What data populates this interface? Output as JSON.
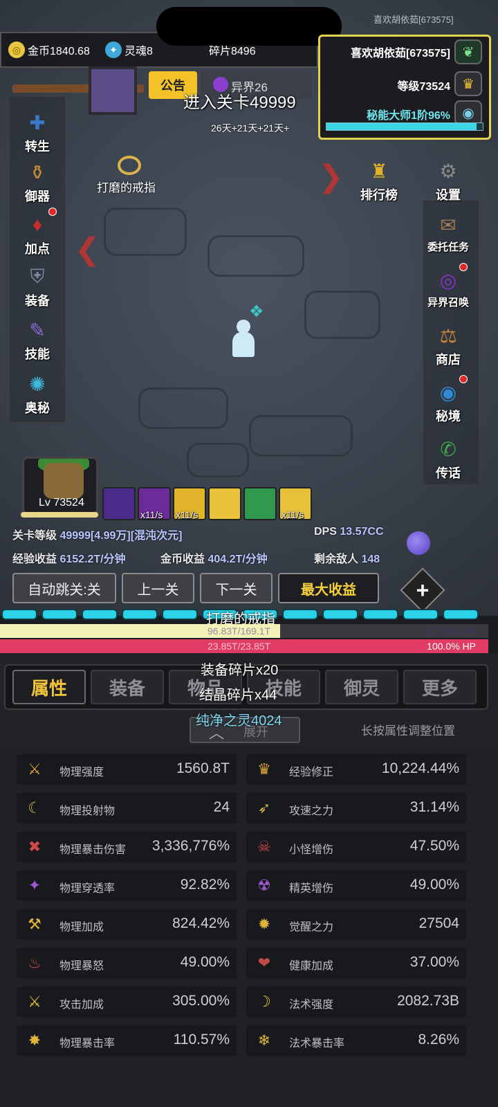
{
  "status": {
    "user_top": "喜欢胡依茹[673575]"
  },
  "resources": {
    "gold": "金币1840.68",
    "soul": "灵魂8",
    "fragment": "碎片8496"
  },
  "player": {
    "name": "喜欢胡依茹[673575]",
    "level": "等级73524",
    "rank": "秘能大师1阶96%",
    "rank_progress": 0.96
  },
  "tabs_top": {
    "notice": "公告",
    "world": "异界26"
  },
  "stage": {
    "enter_text": "进入关卡49999",
    "buff_days": "26天+21天+21天+"
  },
  "drop": {
    "ring_label": "打磨的戒指"
  },
  "left_menu": [
    {
      "label": "转生",
      "icon": "rebirth-icon",
      "dot": false
    },
    {
      "label": "御器",
      "icon": "artifact-icon",
      "dot": false
    },
    {
      "label": "加点",
      "icon": "attribute-point-icon",
      "dot": true
    },
    {
      "label": "装备",
      "icon": "equipment-icon",
      "dot": false
    },
    {
      "label": "技能",
      "icon": "skill-scroll-icon",
      "dot": false
    },
    {
      "label": "奥秘",
      "icon": "mystery-icon",
      "dot": false
    }
  ],
  "right_menu": [
    {
      "label": "排行榜",
      "icon": "trophy-icon",
      "dot": false
    },
    {
      "label": "设置",
      "icon": "gear-icon",
      "dot": false
    },
    {
      "label": "委托任务",
      "icon": "commission-icon",
      "dot": false
    },
    {
      "label": "异界召唤",
      "icon": "portal-icon",
      "dot": true
    },
    {
      "label": "商店",
      "icon": "shop-icon",
      "dot": false
    },
    {
      "label": "秘境",
      "icon": "secret-realm-icon",
      "dot": true
    },
    {
      "label": "传话",
      "icon": "horn-icon",
      "dot": false
    }
  ],
  "boss": {
    "level": "Lv 73524"
  },
  "skills": [
    {
      "rate": "",
      "color": "#4a2b8a"
    },
    {
      "rate": "x11/s",
      "color": "#6b2b9a"
    },
    {
      "rate": "x11/s",
      "color": "#e0b32a"
    },
    {
      "rate": "",
      "color": "#e8c23a"
    },
    {
      "rate": "",
      "color": "#2f9a4c"
    },
    {
      "rate": "x11/s",
      "color": "#e6c23a"
    }
  ],
  "info": {
    "stage_level_label": "关卡等级",
    "stage_level_value": "49999[4.99万][混沌次元]",
    "dps_label": "DPS",
    "dps_value": "13.57CC",
    "exp_income_label": "经验收益",
    "exp_income_value": "6152.2T/分钟",
    "gold_income_label": "金币收益",
    "gold_income_value": "404.2T/分钟",
    "enemies_label": "剩余敌人",
    "enemies_value": "148"
  },
  "controls": {
    "auto_skip": "自动跳关:关",
    "prev": "上一关",
    "next": "下一关",
    "max_income": "最大收益",
    "plus": "+"
  },
  "progress": {
    "segment_label": "打磨的戒指",
    "segments": 12,
    "exp_text": "96.83T/169.1T",
    "exp_percent": "57.3% EXP",
    "exp_fraction": 0.573,
    "hp_text": "23.85T/23.85T",
    "hp_percent": "100.0% HP",
    "hp_fraction": 1.0
  },
  "bottom_tabs": [
    "属性",
    "装备",
    "物品",
    "技能",
    "御灵",
    "更多"
  ],
  "popups": [
    "装备碎片x20",
    "结晶碎片x44",
    "纯净之灵4024"
  ],
  "panel": {
    "expand": "展开",
    "hint": "长按属性调整位置"
  },
  "stats_left": [
    {
      "name": "物理强度",
      "value": "1560.8T",
      "icon": "sword-icon"
    },
    {
      "name": "物理投射物",
      "value": "24",
      "icon": "boomerang-icon"
    },
    {
      "name": "物理暴击伤害",
      "value": "3,336,776%",
      "icon": "crit-damage-icon"
    },
    {
      "name": "物理穿透率",
      "value": "92.82%",
      "icon": "penetration-icon"
    },
    {
      "name": "物理加成",
      "value": "824.42%",
      "icon": "physical-bonus-icon"
    },
    {
      "name": "物理暴怒",
      "value": "49.00%",
      "icon": "rage-icon"
    },
    {
      "name": "攻击加成",
      "value": "305.00%",
      "icon": "crossed-swords-icon"
    },
    {
      "name": "物理暴击率",
      "value": "110.57%",
      "icon": "crit-rate-icon"
    }
  ],
  "stats_right": [
    {
      "name": "经验修正",
      "value": "10,224.44%",
      "icon": "crown-icon"
    },
    {
      "name": "攻速之力",
      "value": "31.14%",
      "icon": "attack-speed-icon"
    },
    {
      "name": "小怪增伤",
      "value": "47.50%",
      "icon": "minion-damage-icon"
    },
    {
      "name": "精英增伤",
      "value": "49.00%",
      "icon": "elite-damage-icon"
    },
    {
      "name": "觉醒之力",
      "value": "27504",
      "icon": "awaken-icon"
    },
    {
      "name": "健康加成",
      "value": "37.00%",
      "icon": "health-heart-icon"
    },
    {
      "name": "法术强度",
      "value": "2082.73B",
      "icon": "spell-power-icon"
    },
    {
      "name": "法术暴击率",
      "value": "8.26%",
      "icon": "spell-crit-icon"
    }
  ]
}
